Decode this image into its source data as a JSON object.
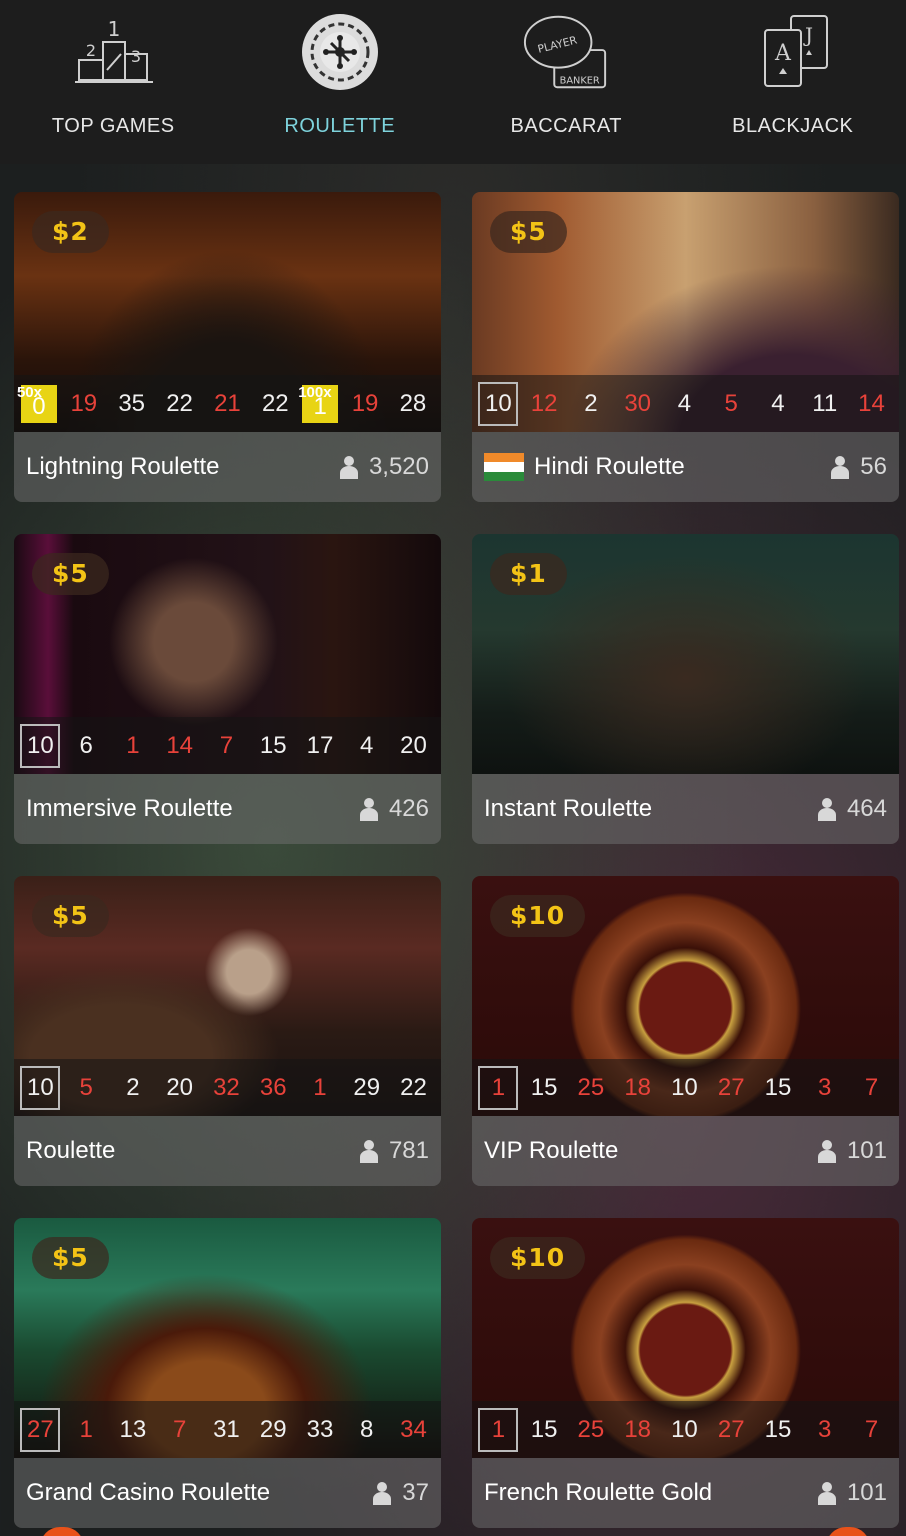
{
  "nav": {
    "items": [
      {
        "label": "TOP GAMES",
        "icon": "podium-icon",
        "active": false
      },
      {
        "label": "ROULETTE",
        "icon": "roulette-wheel-icon",
        "active": true
      },
      {
        "label": "BACCARAT",
        "icon": "baccarat-icon",
        "active": false
      },
      {
        "label": "BLACKJACK",
        "icon": "playing-cards-icon",
        "active": false
      }
    ],
    "podium_digits": [
      "1",
      "2",
      "3"
    ],
    "baccarat_text": [
      "PLAYER",
      "BANKER"
    ],
    "cards": [
      "A",
      "J"
    ]
  },
  "games": [
    {
      "name": "Lightning Roulette",
      "bet": "$2",
      "players": "3,520",
      "results": [
        {
          "n": "0",
          "c": "green",
          "mult": "50x"
        },
        {
          "n": "19",
          "c": "red"
        },
        {
          "n": "35",
          "c": "black"
        },
        {
          "n": "22",
          "c": "black"
        },
        {
          "n": "21",
          "c": "red"
        },
        {
          "n": "22",
          "c": "black"
        },
        {
          "n": "1",
          "c": "red",
          "mult": "100x"
        },
        {
          "n": "19",
          "c": "red"
        },
        {
          "n": "28",
          "c": "black"
        }
      ]
    },
    {
      "name": "Hindi Roulette",
      "bet": "$5",
      "players": "56",
      "flag": "india",
      "results": [
        {
          "n": "10",
          "c": "black"
        },
        {
          "n": "12",
          "c": "red"
        },
        {
          "n": "2",
          "c": "black"
        },
        {
          "n": "30",
          "c": "red"
        },
        {
          "n": "4",
          "c": "black"
        },
        {
          "n": "5",
          "c": "red"
        },
        {
          "n": "4",
          "c": "black"
        },
        {
          "n": "11",
          "c": "black"
        },
        {
          "n": "14",
          "c": "red"
        }
      ]
    },
    {
      "name": "Immersive Roulette",
      "bet": "$5",
      "players": "426",
      "results": [
        {
          "n": "10",
          "c": "black"
        },
        {
          "n": "6",
          "c": "black"
        },
        {
          "n": "1",
          "c": "red"
        },
        {
          "n": "14",
          "c": "red"
        },
        {
          "n": "7",
          "c": "red"
        },
        {
          "n": "15",
          "c": "black"
        },
        {
          "n": "17",
          "c": "black"
        },
        {
          "n": "4",
          "c": "black"
        },
        {
          "n": "20",
          "c": "black"
        }
      ]
    },
    {
      "name": "Instant Roulette",
      "bet": "$1",
      "players": "464",
      "results": []
    },
    {
      "name": "Roulette",
      "bet": "$5",
      "players": "781",
      "results": [
        {
          "n": "10",
          "c": "black"
        },
        {
          "n": "5",
          "c": "red"
        },
        {
          "n": "2",
          "c": "black"
        },
        {
          "n": "20",
          "c": "black"
        },
        {
          "n": "32",
          "c": "red"
        },
        {
          "n": "36",
          "c": "red"
        },
        {
          "n": "1",
          "c": "red"
        },
        {
          "n": "29",
          "c": "black"
        },
        {
          "n": "22",
          "c": "black"
        }
      ]
    },
    {
      "name": "VIP Roulette",
      "bet": "$10",
      "players": "101",
      "results": [
        {
          "n": "1",
          "c": "red"
        },
        {
          "n": "15",
          "c": "black"
        },
        {
          "n": "25",
          "c": "red"
        },
        {
          "n": "18",
          "c": "red"
        },
        {
          "n": "10",
          "c": "black"
        },
        {
          "n": "27",
          "c": "red"
        },
        {
          "n": "15",
          "c": "black"
        },
        {
          "n": "3",
          "c": "red"
        },
        {
          "n": "7",
          "c": "red"
        }
      ]
    },
    {
      "name": "Grand Casino Roulette",
      "bet": "$5",
      "players": "37",
      "results": [
        {
          "n": "27",
          "c": "red"
        },
        {
          "n": "1",
          "c": "red"
        },
        {
          "n": "13",
          "c": "black"
        },
        {
          "n": "7",
          "c": "red"
        },
        {
          "n": "31",
          "c": "black"
        },
        {
          "n": "29",
          "c": "black"
        },
        {
          "n": "33",
          "c": "black"
        },
        {
          "n": "8",
          "c": "black"
        },
        {
          "n": "34",
          "c": "red"
        }
      ]
    },
    {
      "name": "French Roulette Gold",
      "bet": "$10",
      "players": "101",
      "results": [
        {
          "n": "1",
          "c": "red"
        },
        {
          "n": "15",
          "c": "black"
        },
        {
          "n": "25",
          "c": "red"
        },
        {
          "n": "18",
          "c": "red"
        },
        {
          "n": "10",
          "c": "black"
        },
        {
          "n": "27",
          "c": "red"
        },
        {
          "n": "15",
          "c": "black"
        },
        {
          "n": "3",
          "c": "red"
        },
        {
          "n": "7",
          "c": "red"
        }
      ]
    }
  ],
  "colors": {
    "accent": "#7ed3dc",
    "bet": "#f3c316",
    "red_number": "#e8423a",
    "lightning": "#e8d414"
  }
}
